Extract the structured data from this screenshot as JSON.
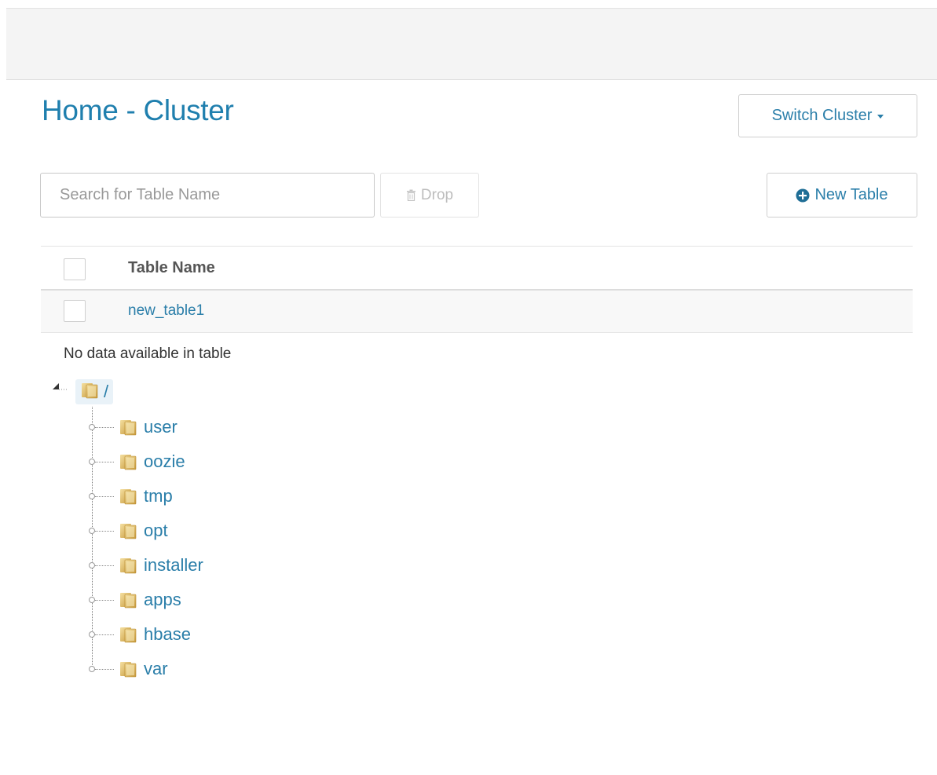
{
  "header": {
    "title": "Home - Cluster",
    "switch_cluster_label": "Switch Cluster"
  },
  "toolbar": {
    "search_placeholder": "Search for Table Name",
    "drop_label": "Drop",
    "new_table_label": "New Table"
  },
  "table": {
    "column_header": "Table Name",
    "rows": [
      {
        "name": "new_table1"
      }
    ],
    "empty_message": "No data available in table"
  },
  "tree": {
    "root_label": "/",
    "items": [
      {
        "label": "user"
      },
      {
        "label": "oozie"
      },
      {
        "label": "tmp"
      },
      {
        "label": "opt"
      },
      {
        "label": "installer"
      },
      {
        "label": "apps"
      },
      {
        "label": "hbase"
      },
      {
        "label": "var"
      }
    ]
  },
  "colors": {
    "accent": "#2a7ea9",
    "title": "#1f7fae",
    "folder": "#d9b86a"
  }
}
